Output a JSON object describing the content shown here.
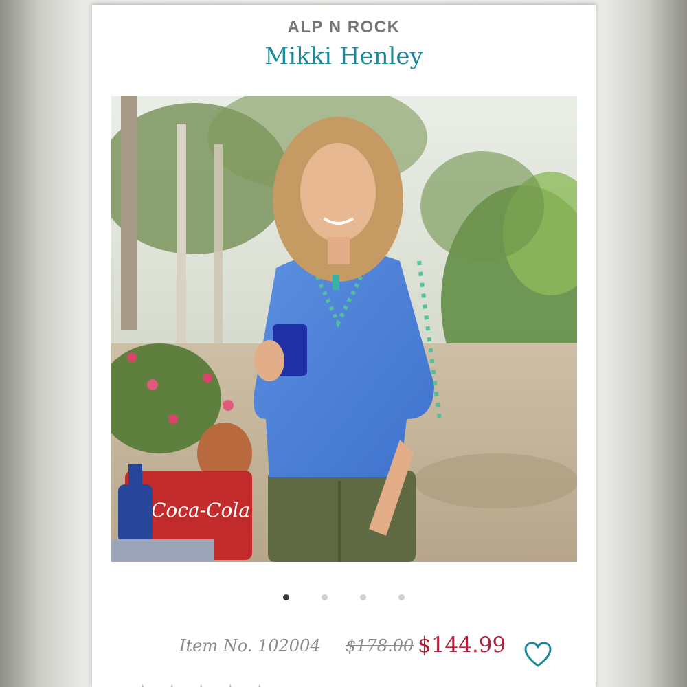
{
  "product": {
    "brand": "ALP N ROCK",
    "title": "Mikki Henley",
    "image_alt": "Woman in blue embroidered henley holding a blue glass",
    "sign_text": "Coca-Cola",
    "item_number": "Item No. 102004",
    "original_price": "$178.00",
    "sale_price": "$144.99"
  },
  "carousel": {
    "dot_count": 4,
    "active_index": 0
  },
  "rating": {
    "stars_text": "★ ★ ★ ★ ★"
  },
  "icons": {
    "wishlist": "heart-outline-icon"
  },
  "colors": {
    "title": "#1a8a9a",
    "sale_price": "#b01e3a",
    "muted_text": "#8a8a8a",
    "heart": "#1a8a9a"
  }
}
